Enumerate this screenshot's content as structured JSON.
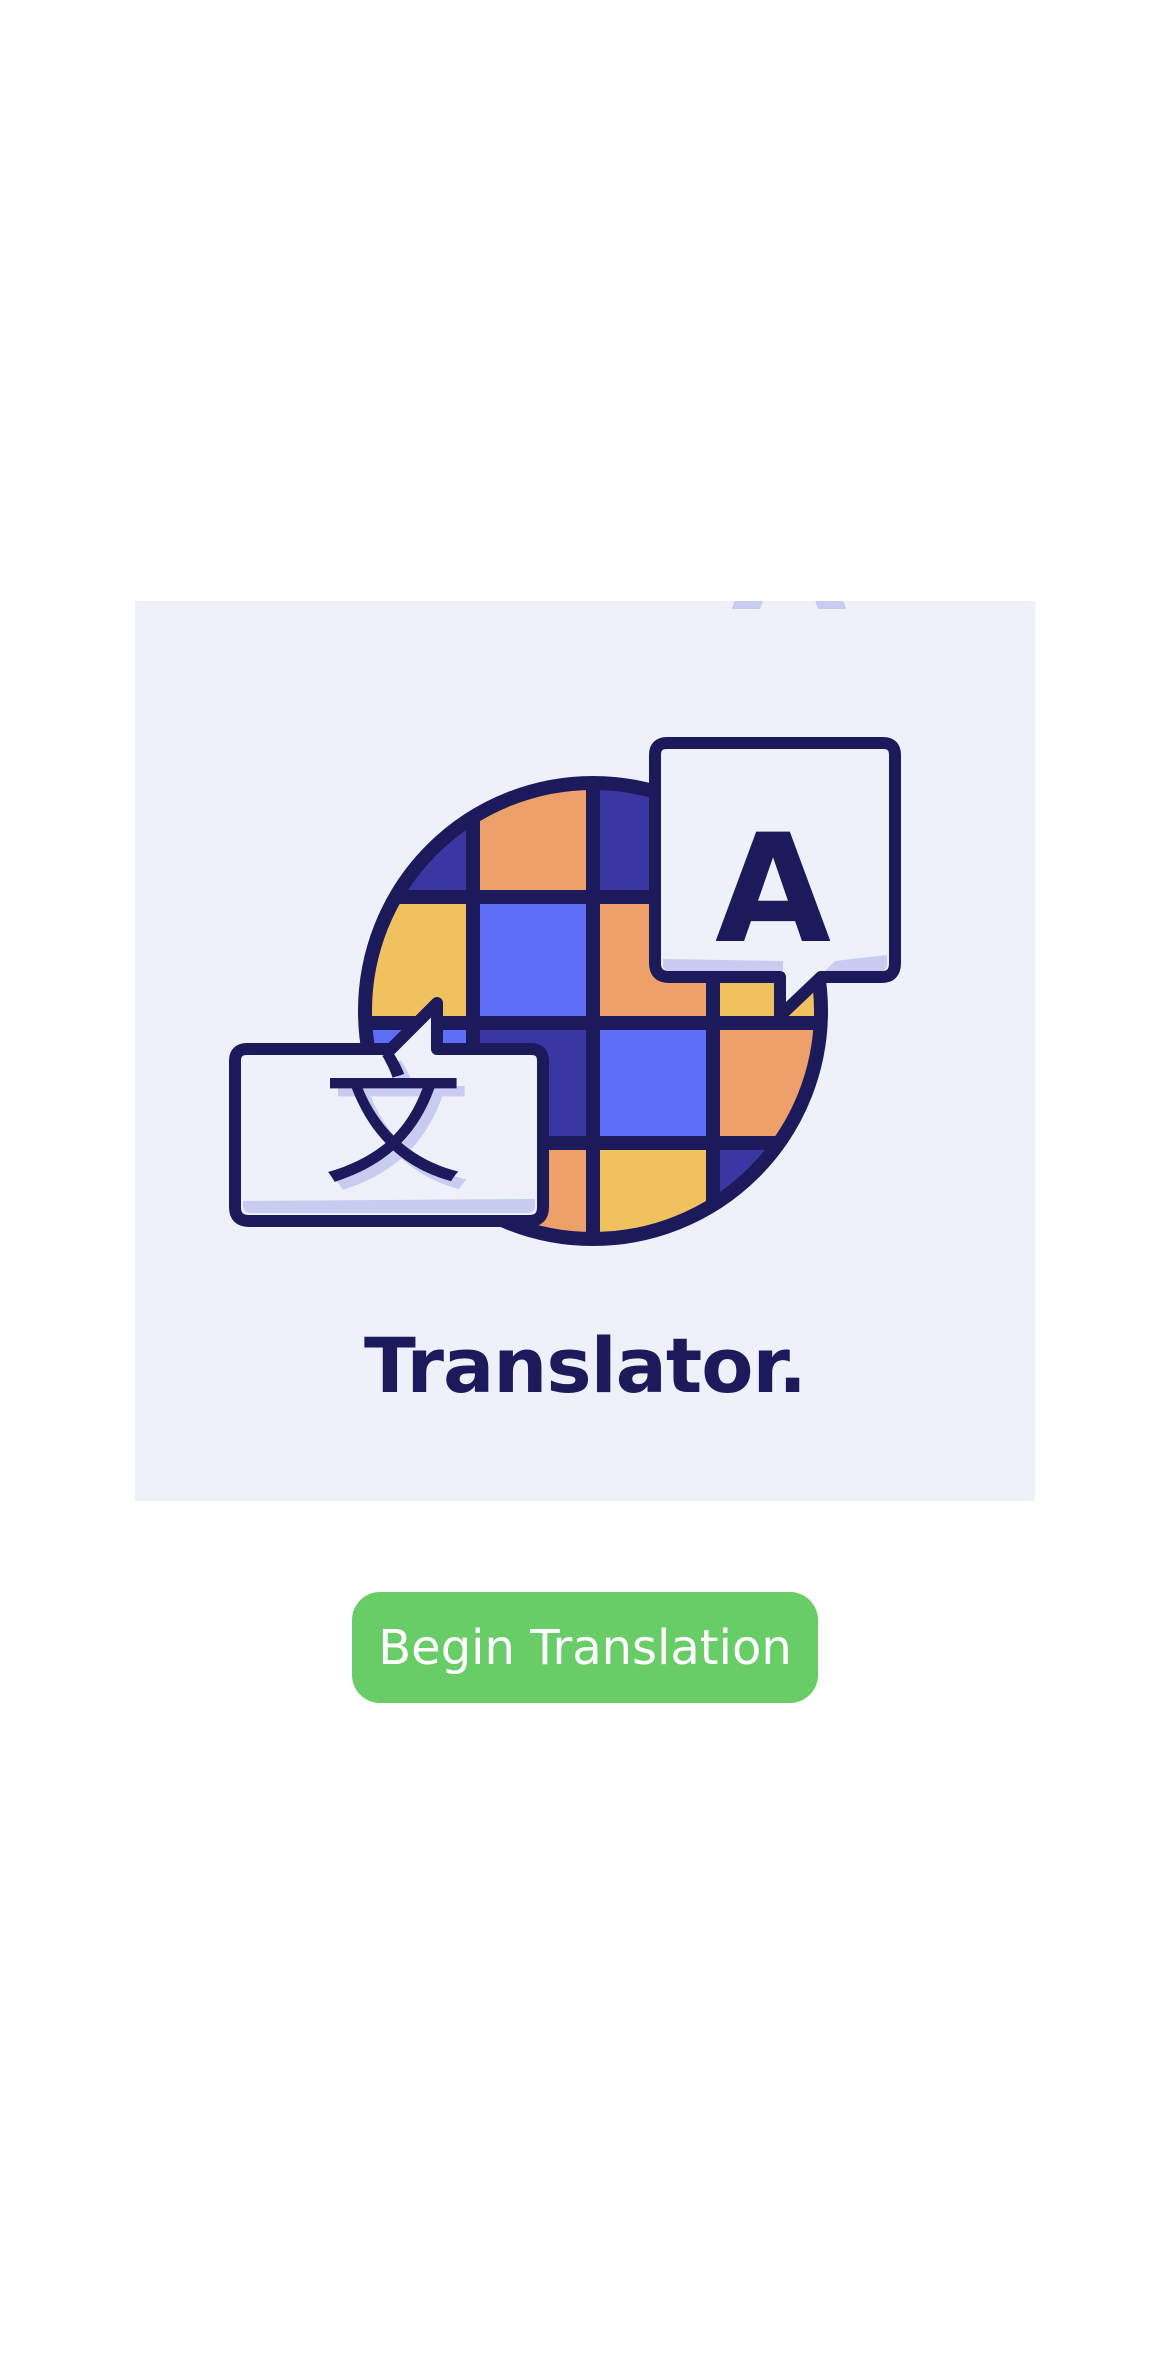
{
  "app": {
    "title": "Translator.",
    "begin_button_label": "Begin Translation"
  },
  "logo": {
    "source_glyph": "文",
    "target_glyph": "A"
  },
  "colors": {
    "card_background": "#eef0fa",
    "outline": "#1c1a5a",
    "globe_orange": "#eea06a",
    "globe_yellow": "#f0c15f",
    "globe_blue": "#5b6ef5",
    "globe_indigo": "#3b37a2",
    "bubble_shadow": "#c9ccf1",
    "button_green": "#68cd67",
    "button_text": "#ffffff"
  }
}
